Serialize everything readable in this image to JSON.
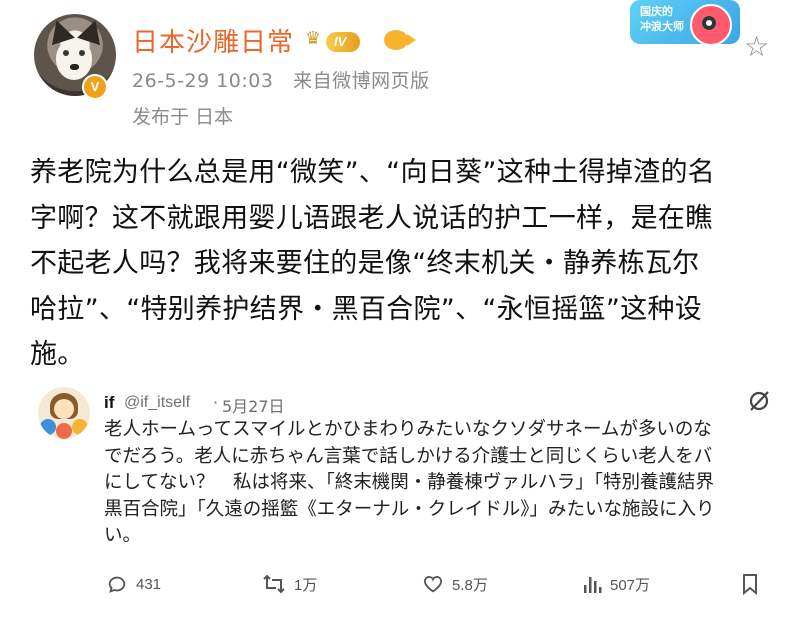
{
  "post": {
    "username": "日本沙雕日常",
    "level_badge": "IV",
    "vip_badge": "V",
    "timestamp": "26-5-29 10:03",
    "source": "来自微博网页版",
    "location": "发布于 日本",
    "text": "养老院为什么总是用“微笑”、“向日葵”这种土得掉渣的名\n字啊？这不就跟用婴儿语跟老人说话的护工一样，是在瞧\n不起老人吗？我将来要住的是像“终末机关・静养栋瓦尔\n哈拉”、“特别养护结界・黑百合院”、“永恒摇篮”这种设\n施。"
  },
  "sticker": {
    "label": "国庆的\n冲浪大师"
  },
  "quoted": {
    "name": "if",
    "handle": "@if_itself",
    "separator": "·",
    "date": "5月27日",
    "text": "老人ホームってスマイルとかひまわりみたいなクソダサネームが多いのな\nでだろう。老人に赤ちゃん言葉で話しかける介護士と同じくらい老人をバ\nにしてない？　私は将来、「終末機関・静養棟ヴァルハラ」「特別養護結界\n黒百合院」「久遠の揺籃《エターナル・クレイドル》」みたいな施設に入り\nい。",
    "actions": {
      "replies": "431",
      "reposts": "1万",
      "likes": "5.8万",
      "views": "507万"
    }
  },
  "colors": {
    "username": "#e8672a",
    "meta": "#8a8a8a",
    "vip": "#f0a21a"
  }
}
